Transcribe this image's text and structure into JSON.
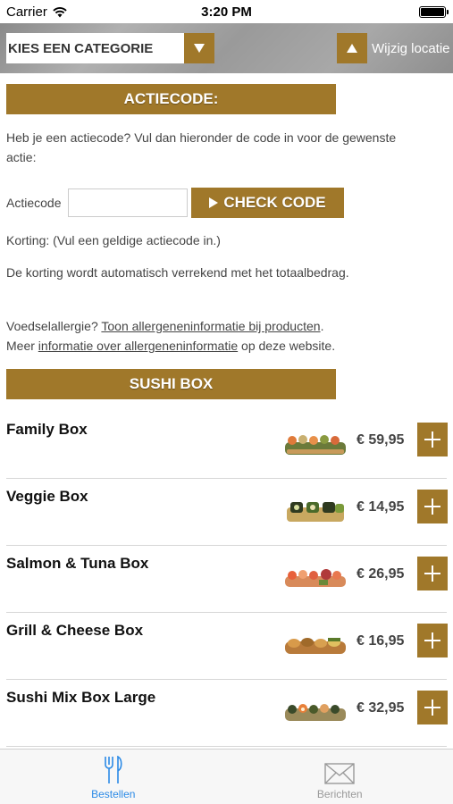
{
  "status_bar": {
    "carrier": "Carrier",
    "time": "3:20 PM"
  },
  "header": {
    "category_label": "KIES EEN CATEGORIE",
    "location_label": "Wijzig locatie",
    "accent_color": "#a0782a"
  },
  "actiecode": {
    "banner": "ACTIECODE:",
    "intro_line1": "Heb je een actiecode? Vul dan hieronder de code in voor de gewenste",
    "intro_line2": "actie:",
    "input_label": "Actiecode",
    "input_value": "",
    "check_button": "CHECK CODE",
    "korting": "Korting: (Vul een geldige actiecode in.)",
    "verrekend": "De korting wordt automatisch verrekend met het totaalbedrag."
  },
  "allergy": {
    "prefix1": "Voedselallergie? ",
    "link1": "Toon allergeneninformatie bij producten",
    "suffix1": ".",
    "prefix2": "Meer ",
    "link2": "informatie over allergeneninformatie",
    "suffix2": " op deze website."
  },
  "section": {
    "title": "SUSHI BOX"
  },
  "products": [
    {
      "name": "Family Box",
      "price": "€ 59,95",
      "image_icon": "sushi-box-image"
    },
    {
      "name": "Veggie Box",
      "price": "€ 14,95",
      "image_icon": "sushi-box-image"
    },
    {
      "name": "Salmon & Tuna Box",
      "price": "€ 26,95",
      "image_icon": "sushi-box-image"
    },
    {
      "name": "Grill & Cheese Box",
      "price": "€ 16,95",
      "image_icon": "sushi-box-image"
    },
    {
      "name": "Sushi Mix Box Large",
      "price": "€ 32,95",
      "image_icon": "sushi-box-image"
    }
  ],
  "tabs": [
    {
      "label": "Bestellen",
      "icon": "fork-knife-icon",
      "active": true
    },
    {
      "label": "Berichten",
      "icon": "envelope-icon",
      "active": false
    }
  ]
}
